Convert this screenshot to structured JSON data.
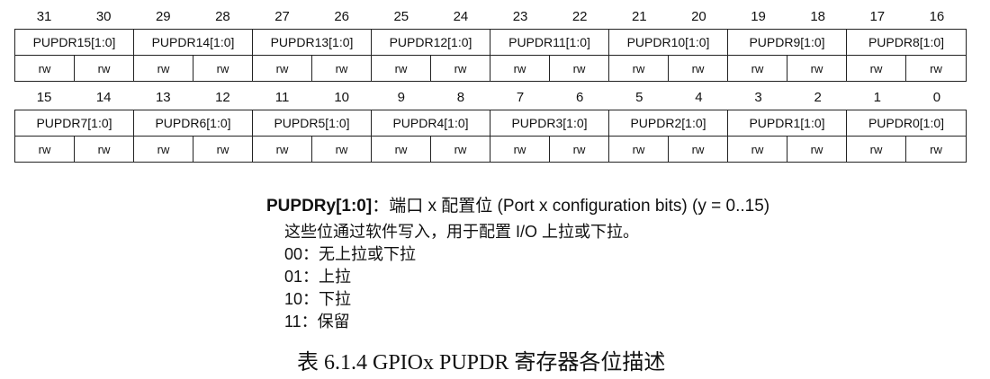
{
  "register_upper": {
    "bit_numbers": [
      "31",
      "30",
      "29",
      "28",
      "27",
      "26",
      "25",
      "24",
      "23",
      "22",
      "21",
      "20",
      "19",
      "18",
      "17",
      "16"
    ],
    "fields": [
      "PUPDR15[1:0]",
      "PUPDR14[1:0]",
      "PUPDR13[1:0]",
      "PUPDR12[1:0]",
      "PUPDR11[1:0]",
      "PUPDR10[1:0]",
      "PUPDR9[1:0]",
      "PUPDR8[1:0]"
    ],
    "access": [
      "rw",
      "rw",
      "rw",
      "rw",
      "rw",
      "rw",
      "rw",
      "rw",
      "rw",
      "rw",
      "rw",
      "rw",
      "rw",
      "rw",
      "rw",
      "rw"
    ]
  },
  "register_lower": {
    "bit_numbers": [
      "15",
      "14",
      "13",
      "12",
      "11",
      "10",
      "9",
      "8",
      "7",
      "6",
      "5",
      "4",
      "3",
      "2",
      "1",
      "0"
    ],
    "fields": [
      "PUPDR7[1:0]",
      "PUPDR6[1:0]",
      "PUPDR5[1:0]",
      "PUPDR4[1:0]",
      "PUPDR3[1:0]",
      "PUPDR2[1:0]",
      "PUPDR1[1:0]",
      "PUPDR0[1:0]"
    ],
    "access": [
      "rw",
      "rw",
      "rw",
      "rw",
      "rw",
      "rw",
      "rw",
      "rw",
      "rw",
      "rw",
      "rw",
      "rw",
      "rw",
      "rw",
      "rw",
      "rw"
    ]
  },
  "description": {
    "field_name": "PUPDRy[1:0]",
    "heading_text": "：端口 x 配置位 (Port x configuration bits) (y = 0..15)",
    "lines": [
      "这些位通过软件写入，用于配置 I/O 上拉或下拉。",
      "00：无上拉或下拉",
      "01：上拉",
      "10：下拉",
      "11：保留"
    ]
  },
  "caption": "表 6.1.4 GPIOx PUPDR 寄存器各位描述"
}
